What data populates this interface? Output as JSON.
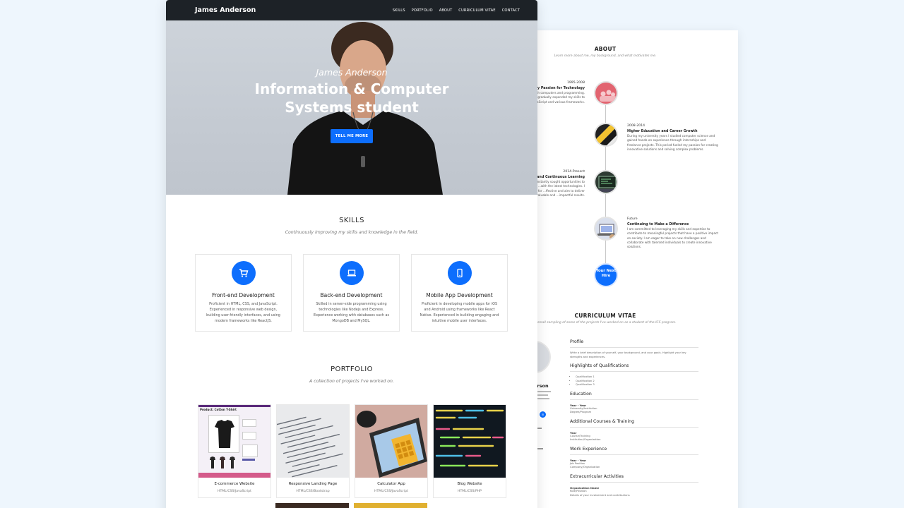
{
  "nav": {
    "brand": "James Anderson",
    "items": [
      "SKILLS",
      "PORTFOLIO",
      "ABOUT",
      "CURRICULUM VITAE",
      "CONTACT"
    ]
  },
  "hero": {
    "name": "James Anderson",
    "title": "Information & Computer Systems student",
    "button": "TELL ME MORE"
  },
  "skills": {
    "title": "SKILLS",
    "subtitle": "Continuously improving my skills and knowledge in the field.",
    "cards": [
      {
        "icon": "cart-icon",
        "title": "Front-end Development",
        "desc": "Proficient in HTML, CSS, and JavaScript. Experienced in responsive web design, building user-friendly interfaces, and using modern frameworks like ReactJS."
      },
      {
        "icon": "laptop-icon",
        "title": "Back-end Development",
        "desc": "Skilled in server-side programming using technologies like Nodejs and Express. Experience working with databases such as MongoDB and MySQL."
      },
      {
        "icon": "mobile-icon",
        "title": "Mobile App Development",
        "desc": "Proficient in developing mobile apps for iOS and Android using frameworks like React Native. Experienced in building engaging and intuitive mobile user interfaces."
      }
    ]
  },
  "portfolio": {
    "title": "PORTFOLIO",
    "subtitle": "A collection of projects I've worked on.",
    "items": [
      {
        "name": "E-commerce Website",
        "tech": "HTML/CSS/JavaScript"
      },
      {
        "name": "Responsive Landing Page",
        "tech": "HTML/CSS/Bootstrap"
      },
      {
        "name": "Calculator App",
        "tech": "HTML/CSS/JavaScript"
      },
      {
        "name": "Blog Website",
        "tech": "HTML/CSS/PHP"
      }
    ],
    "shop_img_text": "Product: Cotton T-Shirt"
  },
  "about": {
    "title": "ABOUT",
    "subtitle": "Learn more about me, my background, and what motivates me.",
    "timeline": [
      {
        "year": "1995-2008",
        "title": "Early Passion for Technology",
        "text": "...ted with computers and programming. ...HTML I gradually expanded my skills to ...ide JavaScript and various frameworks."
      },
      {
        "year": "2008-2014",
        "title": "Higher Education and Career Growth",
        "text": "During my university years I studied computer science and gained hands-on experience through internships and freelance projects. This period fueled my passion for creating innovative solutions and solving complex problems."
      },
      {
        "year": "2014-Present",
        "title": "...ence and Continuous Learning",
        "text": "...constantly sought opportunities to refine ...with the latest technologies. I strive for ...ffective and aim to deliver valuable and ...impactful results."
      },
      {
        "year": "Future",
        "title": "Continuing to Make a Difference",
        "text": "I am committed to leveraging my skills and expertise to contribute to meaningful projects that have a positive impact on society. I am eager to take on new challenges and collaborate with talented individuals to create innovative solutions."
      }
    ],
    "hire": "Your Next Hire"
  },
  "cv": {
    "title": "CURRICULUM VITAE",
    "subtitle": "A small sampling of some of the projects I've worked on as a student of the ICS program.",
    "name_fragment": "erson",
    "sections": {
      "profile": "Profile",
      "profile_text": "Write a brief description of yourself, your background, and your goals. Highlight your key strengths and experiences.",
      "highlights": "Highlights of Qualifications",
      "qualifications": [
        "Qualification 1",
        "Qualification 2",
        "Qualification 3"
      ],
      "education": "Education",
      "education_year": "Year - Year",
      "education_inst": "University/Institution",
      "education_degree": "Degree/Program",
      "courses": "Additional Courses & Training",
      "courses_year": "Year",
      "courses_name": "Course/Training",
      "courses_inst": "Institution/Organization",
      "work": "Work Experience",
      "work_year": "Year - Year",
      "work_pos": "Job Position",
      "work_co": "Company/Organization",
      "extra": "Extracurricular Activities",
      "extra_org": "Organization Name",
      "extra_role": "Role/Position",
      "extra_text": "Details of your involvement and contributions"
    }
  },
  "colors": {
    "accent": "#0d6efd",
    "nav": "#1d2227",
    "background": "#eef6fd"
  }
}
